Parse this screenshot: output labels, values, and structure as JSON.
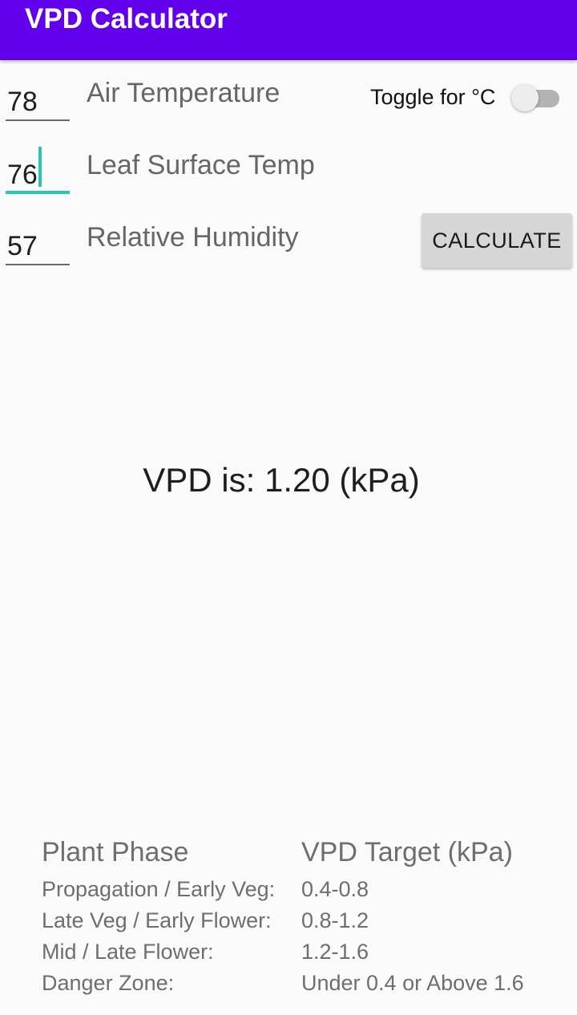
{
  "app": {
    "title": "VPD Calculator",
    "colors": {
      "primary": "#6200ee",
      "accent": "#26c6b0"
    }
  },
  "inputs": [
    {
      "value": "78",
      "label": "Air Temperature",
      "focused": false
    },
    {
      "value": "76",
      "label": "Leaf Surface Temp",
      "focused": true
    },
    {
      "value": "57",
      "label": "Relative Humidity",
      "focused": false
    }
  ],
  "toggle": {
    "label": "Toggle for °C",
    "checked": false
  },
  "calculate_button": {
    "label": "CALCULATE"
  },
  "result": {
    "text": "VPD is: 1.20 (kPa)"
  },
  "reference_table": {
    "headers": [
      "Plant Phase",
      "VPD Target (kPa)"
    ],
    "rows": [
      [
        "Propagation / Early Veg:",
        "0.4-0.8"
      ],
      [
        "Late Veg / Early Flower:",
        "0.8-1.2"
      ],
      [
        "Mid / Late Flower:",
        "1.2-1.6"
      ],
      [
        "Danger Zone:",
        "Under 0.4 or Above 1.6"
      ]
    ]
  }
}
